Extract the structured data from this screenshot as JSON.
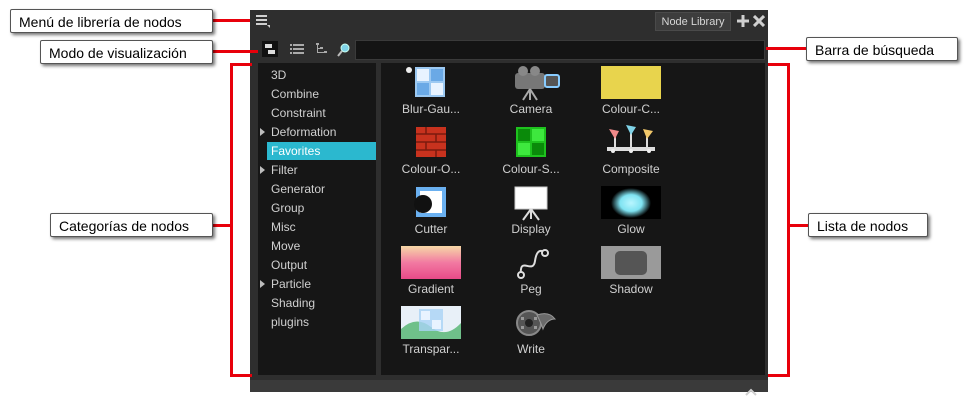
{
  "callouts": {
    "menu": "Menú de librería de nodos",
    "view_mode": "Modo de visualización",
    "categories": "Categorías de nodos",
    "search": "Barra de búsqueda",
    "node_list": "Lista de nodos"
  },
  "panel": {
    "tab_title": "Node Library",
    "search": {
      "value": "",
      "placeholder": ""
    }
  },
  "categories": [
    {
      "label": "3D",
      "expandable": false
    },
    {
      "label": "Combine",
      "expandable": false
    },
    {
      "label": "Constraint",
      "expandable": false
    },
    {
      "label": "Deformation",
      "expandable": true
    },
    {
      "label": "Favorites",
      "expandable": false,
      "selected": true
    },
    {
      "label": "Filter",
      "expandable": true
    },
    {
      "label": "Generator",
      "expandable": false
    },
    {
      "label": "Group",
      "expandable": false
    },
    {
      "label": "Misc",
      "expandable": false
    },
    {
      "label": "Move",
      "expandable": false
    },
    {
      "label": "Output",
      "expandable": false
    },
    {
      "label": "Particle",
      "expandable": true
    },
    {
      "label": "Shading",
      "expandable": false
    },
    {
      "label": "plugins",
      "expandable": false
    }
  ],
  "nodes": [
    {
      "label": "Blur-Gau...",
      "icon": "blur-gaussian-icon"
    },
    {
      "label": "Camera",
      "icon": "camera-icon"
    },
    {
      "label": "Colour-C...",
      "icon": "colour-card-icon"
    },
    {
      "label": "Colour-O...",
      "icon": "colour-override-icon"
    },
    {
      "label": "Colour-S...",
      "icon": "colour-screen-icon"
    },
    {
      "label": "Composite",
      "icon": "composite-icon"
    },
    {
      "label": "Cutter",
      "icon": "cutter-icon"
    },
    {
      "label": "Display",
      "icon": "display-icon"
    },
    {
      "label": "Glow",
      "icon": "glow-icon"
    },
    {
      "label": "Gradient",
      "icon": "gradient-icon"
    },
    {
      "label": "Peg",
      "icon": "peg-icon"
    },
    {
      "label": "Shadow",
      "icon": "shadow-icon"
    },
    {
      "label": "Transpar...",
      "icon": "transparency-icon"
    },
    {
      "label": "Write",
      "icon": "write-icon"
    }
  ],
  "colors": {
    "accent": "#2bb8cf",
    "callout_line": "#e8000b",
    "panel_bg": "#2e2e2e",
    "pane_bg": "#161616"
  }
}
